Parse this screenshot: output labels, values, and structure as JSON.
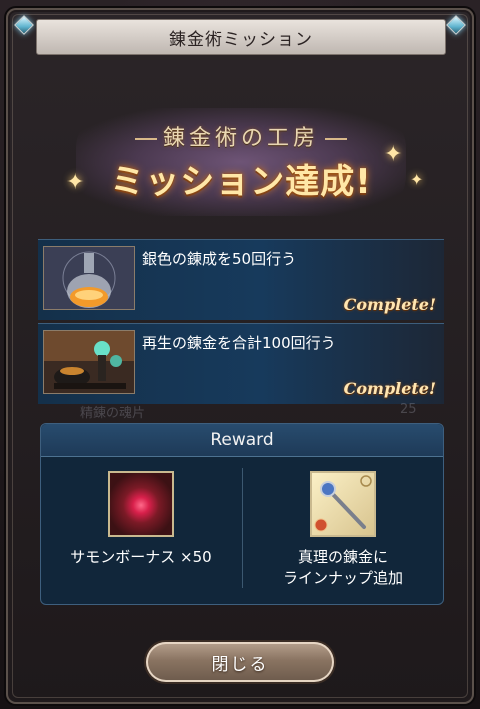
{
  "window": {
    "title": "錬金術ミッション"
  },
  "banner": {
    "subtitle": "錬金術の工房",
    "headline": "ミッション達成!"
  },
  "missions": [
    {
      "text": "銀色の錬成を50回行う",
      "status": "Complete!",
      "icon": "potion-flask-icon"
    },
    {
      "text": "再生の錬金を合計100回行う",
      "status": "Complete!",
      "icon": "alchemy-apparatus-icon"
    }
  ],
  "background_ghosts": {
    "text1": "精錬の魂片",
    "value1": "25"
  },
  "reward": {
    "header": "Reward",
    "items": [
      {
        "label": "サモンボーナス ×50",
        "icon": "red-orb-icon"
      },
      {
        "label_line1": "真理の錬金に",
        "label_line2": "ラインナップ追加",
        "icon": "staff-weapon-icon"
      }
    ]
  },
  "buttons": {
    "close_label": "閉じる"
  },
  "colors": {
    "accent_gold": "#ffe7a7",
    "panel_blue": "#173a5c",
    "gem_cyan": "#5fb4cf"
  }
}
